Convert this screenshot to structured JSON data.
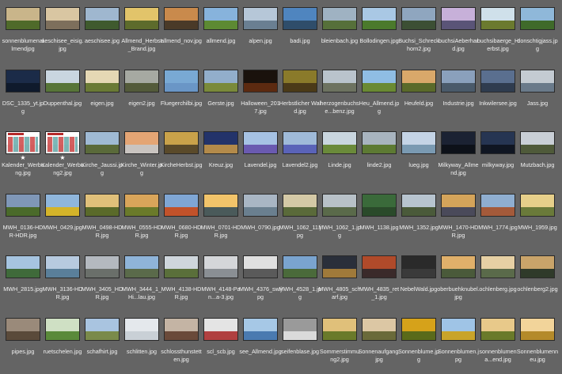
{
  "rows": [
    [
      {
        "name": "sonnenblumenallmendjpg",
        "sky": "#c9b58a",
        "ground": "#4f6a2a"
      },
      {
        "name": "aeschisee_eisig.jpg",
        "sky": "#d9c6a2",
        "ground": "#7d6f5c"
      },
      {
        "name": "aeschisee.jpg",
        "sky": "#9fb7cf",
        "ground": "#3f5a2e"
      },
      {
        "name": "Allmend_Herbst_Brand.jpg",
        "sky": "#e2c46a",
        "ground": "#5d6b2c"
      },
      {
        "name": "allmend_nov.jpg",
        "sky": "#c98a4c",
        "ground": "#4a3a28"
      },
      {
        "name": "allmend.jpg",
        "sky": "#87b3dc",
        "ground": "#5d8a33"
      },
      {
        "name": "alpen.jpg",
        "sky": "#b6c7d8",
        "ground": "#6a7f92"
      },
      {
        "name": "badi.jpg",
        "sky": "#4f85bf",
        "ground": "#2f4d6a"
      },
      {
        "name": "bleienbach.jpg",
        "sky": "#9fb2c2",
        "ground": "#56703a"
      },
      {
        "name": "Bollodingen.jpg",
        "sky": "#a9c8e4",
        "ground": "#4b7a2c"
      },
      {
        "name": "Buchsi_Schreckhorn2.jpg",
        "sky": "#8fa6bf",
        "ground": "#3c4f34"
      },
      {
        "name": "buchsiAeberhard.jpg",
        "sky": "#c7b0d9",
        "ground": "#5a5477"
      },
      {
        "name": "buchsibaerge_Herbst.jpg",
        "sky": "#cfe0ea",
        "ground": "#6b7a2f"
      },
      {
        "name": "donschtigjass.jpg",
        "sky": "#8fb8d9",
        "ground": "#3f6a2a"
      }
    ],
    [
      {
        "name": "DSC_1335_yt.jpg",
        "sky": "#1b2b48",
        "ground": "#0f1a2c"
      },
      {
        "name": "Duppenthal.jpg",
        "sky": "#c9d6e0",
        "ground": "#577538"
      },
      {
        "name": "eigen.jpg",
        "sky": "#e5d8b4",
        "ground": "#6a7a35"
      },
      {
        "name": "eigen2.jpg",
        "sky": "#a6a9a2",
        "ground": "#535a3a"
      },
      {
        "name": "Fluegerchilbi.jpg",
        "sky": "#79a9d4",
        "ground": "#6a96c6"
      },
      {
        "name": "Gerste.jpg",
        "sky": "#92aecb",
        "ground": "#7a8a3a"
      },
      {
        "name": "Halloween_2017.jpg",
        "sky": "#1a120c",
        "ground": "#5c2a10"
      },
      {
        "name": "Herbstlicher Wald.jpg",
        "sky": "#8a7a2a",
        "ground": "#4b3a18"
      },
      {
        "name": "herzogenbuchse...benz.jpg",
        "sky": "#b9c3cc",
        "ground": "#6d7260"
      },
      {
        "name": "Heu_Allmend.jpg",
        "sky": "#8fbde4",
        "ground": "#6a8a33"
      },
      {
        "name": "Heufeld.jpg",
        "sky": "#d9a86a",
        "ground": "#5a6a2a"
      },
      {
        "name": "Industrie.jpg",
        "sky": "#8aa0bc",
        "ground": "#4a5a6a"
      },
      {
        "name": "Inkwilersee.jpg",
        "sky": "#5a6f8f",
        "ground": "#2f3c4f"
      },
      {
        "name": "Jass.jpg",
        "sky": "#c4cbd2",
        "ground": "#6a7a8a"
      }
    ],
    [
      {
        "name": "Kalender_Werbung.jpg",
        "sky": "#ffffff",
        "ground": "#e8e8e8",
        "calendar": true,
        "star": "★"
      },
      {
        "name": "Kalender_Werbung2.jpg",
        "sky": "#ffffff",
        "ground": "#e8e8e8",
        "calendar": true,
        "star": "★"
      },
      {
        "name": "Kirche_Jaussi.jpg",
        "sky": "#9fbad4",
        "ground": "#5a6a3a"
      },
      {
        "name": "Kirche_Winter.jpg",
        "sky": "#e4a574",
        "ground": "#c9c4c0"
      },
      {
        "name": "KircheHerbst.jpg",
        "sky": "#c9a24a",
        "ground": "#5a4a2a"
      },
      {
        "name": "Kreuz.jpg",
        "sky": "#23336a",
        "ground": "#b38a4a"
      },
      {
        "name": "Lavendel.jpg",
        "sky": "#a6c2e4",
        "ground": "#6a5ab0"
      },
      {
        "name": "Lavendel2.jpg",
        "sky": "#9fbad9",
        "ground": "#5a63b8"
      },
      {
        "name": "Linde.jpg",
        "sky": "#c9d6df",
        "ground": "#6a8a3a"
      },
      {
        "name": "linde2.jpg",
        "sky": "#a8b4bf",
        "ground": "#5d7a33"
      },
      {
        "name": "lueg.jpg",
        "sky": "#c4d4e6",
        "ground": "#7a9ab2"
      },
      {
        "name": "Milkyway_Allmend.jpg",
        "sky": "#1b2233",
        "ground": "#0d1119"
      },
      {
        "name": "milkyway.jpg",
        "sky": "#263552",
        "ground": "#101622"
      },
      {
        "name": "Mutzbach.jpg",
        "sky": "#c9cfd6",
        "ground": "#4f5a3a"
      }
    ],
    [
      {
        "name": "MWH_0136-HDR-HDR.jpg",
        "sky": "#7f97b7",
        "ground": "#4a6a2a"
      },
      {
        "name": "MWH_0429.jpg",
        "sky": "#8fb6dc",
        "ground": "#d4b42a"
      },
      {
        "name": "MWH_0498-HDR.jpg",
        "sky": "#e0c07a",
        "ground": "#5a6a2a"
      },
      {
        "name": "MWH_0555-HDR.jpg",
        "sky": "#d9a55a",
        "ground": "#6a7a2a"
      },
      {
        "name": "MWH_0680-HDR.jpg",
        "sky": "#7fa6d4",
        "ground": "#c2522a"
      },
      {
        "name": "MWH_0701-HDR.jpg",
        "sky": "#f2c46a",
        "ground": "#4a5a5a"
      },
      {
        "name": "MWH_0790.jpg",
        "sky": "#a9b6c4",
        "ground": "#6a7f8f"
      },
      {
        "name": "MWH_1062_11.jpg",
        "sky": "#d4c9a6",
        "ground": "#5a6a3a"
      },
      {
        "name": "MWH_1062_1.jpg",
        "sky": "#b8c1c8",
        "ground": "#5a6a4a"
      },
      {
        "name": "MWH_1138.jpg",
        "sky": "#3a6a3a",
        "ground": "#2a4a2a"
      },
      {
        "name": "MWH_1352.jpg",
        "sky": "#b7c4cf",
        "ground": "#4a5a3a"
      },
      {
        "name": "MWH_1470-HDR.jpg",
        "sky": "#d4a45a",
        "ground": "#4a4a5a"
      },
      {
        "name": "MWH_1774.jpg",
        "sky": "#8faed0",
        "ground": "#a45a3a"
      },
      {
        "name": "MWH_1959.jpg",
        "sky": "#e6cf8a",
        "ground": "#6a7a3a"
      }
    ],
    [
      {
        "name": "MWH_2815.jpg",
        "sky": "#a6c4e0",
        "ground": "#3f6a3a"
      },
      {
        "name": "MWH_3136-HDR.jpg",
        "sky": "#b7cadf",
        "ground": "#5a7f9a"
      },
      {
        "name": "MWH_3405_HDR.jpg",
        "sky": "#b4b9bf",
        "ground": "#6a6f6a"
      },
      {
        "name": "MWH_3444_1_Hi...lau.jpg",
        "sky": "#8fb4d9",
        "ground": "#5a6a4a"
      },
      {
        "name": "MWH_4138-HDR.jpg",
        "sky": "#cfd6dc",
        "ground": "#5a6f3a"
      },
      {
        "name": "MWH_4148-Pan...a-3.jpg",
        "sky": "#d4d6d9",
        "ground": "#8a8f94"
      },
      {
        "name": "MWH_4376_sw.jpg",
        "sky": "#e0e0e0",
        "ground": "#5a5a5a"
      },
      {
        "name": "MWH_4528_1.jpg",
        "sky": "#7aa4cf",
        "ground": "#4a6a3a"
      },
      {
        "name": "MWH_4805_scharf.jpg",
        "sky": "#2a2f3a",
        "ground": "#a07a3a"
      },
      {
        "name": "MWH_4835_ret_1.jpg",
        "sky": "#b04a2a",
        "ground": "#3a2a2a"
      },
      {
        "name": "NebelWald.jpg",
        "sky": "#2a2a2a",
        "ground": "#3a3a3a"
      },
      {
        "name": "oberbuehknubel.jpg",
        "sky": "#e0b06a",
        "ground": "#4a5a3a"
      },
      {
        "name": "ochlenberg.jpg",
        "sky": "#e6d0a4",
        "ground": "#5a6a4a"
      },
      {
        "name": "ochlenberg2.jpg",
        "sky": "#c9a46a",
        "ground": "#2f3a2a"
      }
    ],
    [
      {
        "name": "pipes.jpg",
        "sky": "#9a8a7a",
        "ground": "#5a4a3a"
      },
      {
        "name": "ruetschelen.jpg",
        "sky": "#cfe0c4",
        "ground": "#5a8a3a"
      },
      {
        "name": "schafhirt.jpg",
        "sky": "#a9c4e0",
        "ground": "#7a8a4a"
      },
      {
        "name": "schlitten.jpg",
        "sky": "#e4e8ec",
        "ground": "#c9d0d6"
      },
      {
        "name": "schlossthunstetten.jpg",
        "sky": "#c4b4a4",
        "ground": "#6a4a3a"
      },
      {
        "name": "scl_scb.jpg",
        "sky": "#e4e4e4",
        "ground": "#b04040"
      },
      {
        "name": "see_Allmend.jpg",
        "sky": "#a6c8e6",
        "ground": "#4a7ab0"
      },
      {
        "name": "seifenblase.jpg",
        "sky": "#9a9a9a",
        "ground": "#dadada"
      },
      {
        "name": "Sommerstimmung2.jpg",
        "sky": "#e0c07a",
        "ground": "#6a7a2a"
      },
      {
        "name": "Sonnenaufgang.jpg",
        "sky": "#dcc7a4",
        "ground": "#6a6a3a"
      },
      {
        "name": "Sonnenblume.jpg",
        "sky": "#d6a21a",
        "ground": "#5a6a1a"
      },
      {
        "name": "Sonnenblumen.jpg",
        "sky": "#9fc4e6",
        "ground": "#c9a42a"
      },
      {
        "name": "sonnenblumena...end.jpg",
        "sky": "#e8c98a",
        "ground": "#6a7a2a"
      },
      {
        "name": "Sonnenblumenneu.jpg",
        "sky": "#f2d49a",
        "ground": "#b48a2a"
      }
    ]
  ]
}
